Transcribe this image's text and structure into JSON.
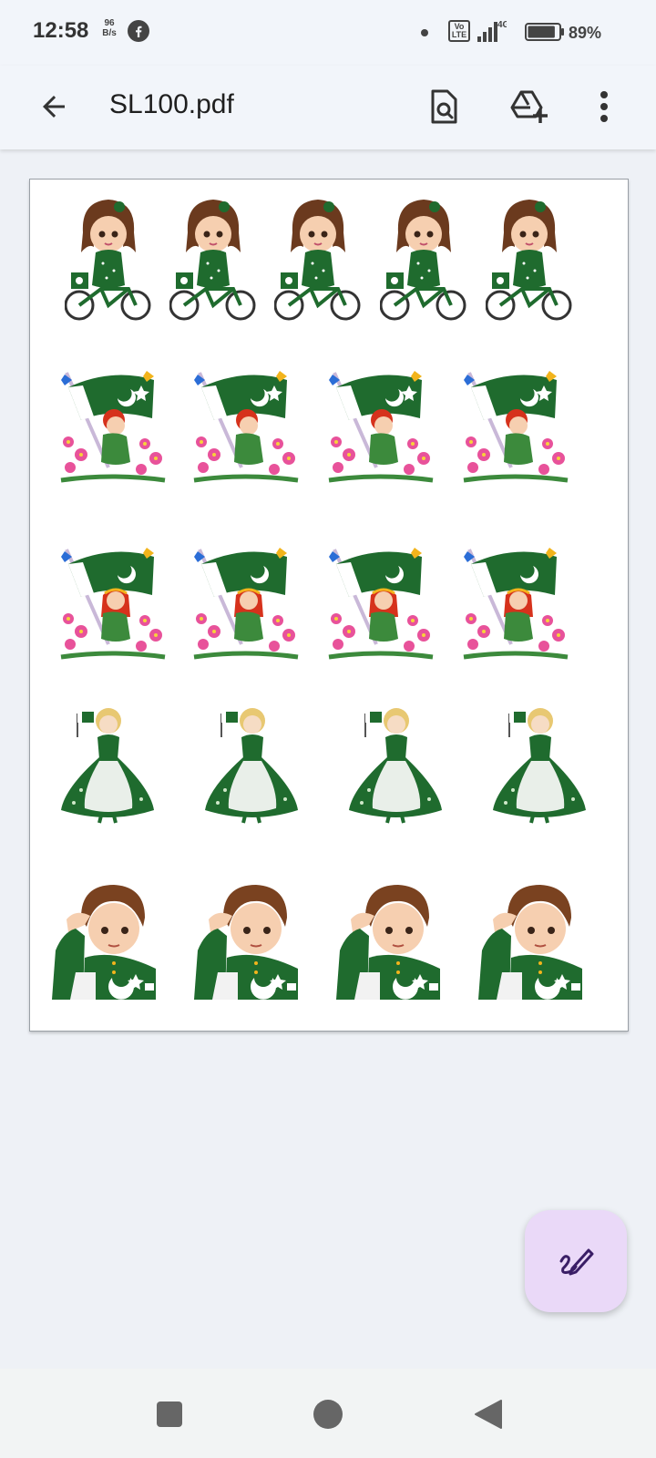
{
  "status_bar": {
    "time": "12:58",
    "net_speed_value": "96",
    "net_speed_unit": "B/s",
    "network_type": "4G",
    "volte_label": "Vo LTE",
    "battery_percent": "89%",
    "battery_level": 0.89
  },
  "toolbar": {
    "title": "SL100.pdf",
    "back_icon": "arrow-left-icon",
    "search_icon": "search-in-document-icon",
    "drive_icon": "add-to-drive-icon",
    "more_icon": "more-vert-icon"
  },
  "document": {
    "rows": [
      {
        "figure": "girl-on-bicycle-with-flag",
        "count": 5
      },
      {
        "figure": "boy-with-flag-in-flowers",
        "count": 4
      },
      {
        "figure": "girl-with-flag-in-flowers",
        "count": 4
      },
      {
        "figure": "girl-in-green-gown-with-flag",
        "count": 4
      },
      {
        "figure": "saluting-boy-in-green-jacket",
        "count": 4
      }
    ]
  },
  "fab": {
    "icon": "edit-annotate-icon"
  },
  "nav_bar": {
    "recents_icon": "square-icon",
    "home_icon": "circle-icon",
    "back_icon": "triangle-back-icon"
  },
  "colors": {
    "background": "#eef1f6",
    "app_bar": "#f2f5fa",
    "fab": "#ead9f8",
    "pak_green": "#1f6b2e",
    "flower_pink": "#e8529a"
  }
}
